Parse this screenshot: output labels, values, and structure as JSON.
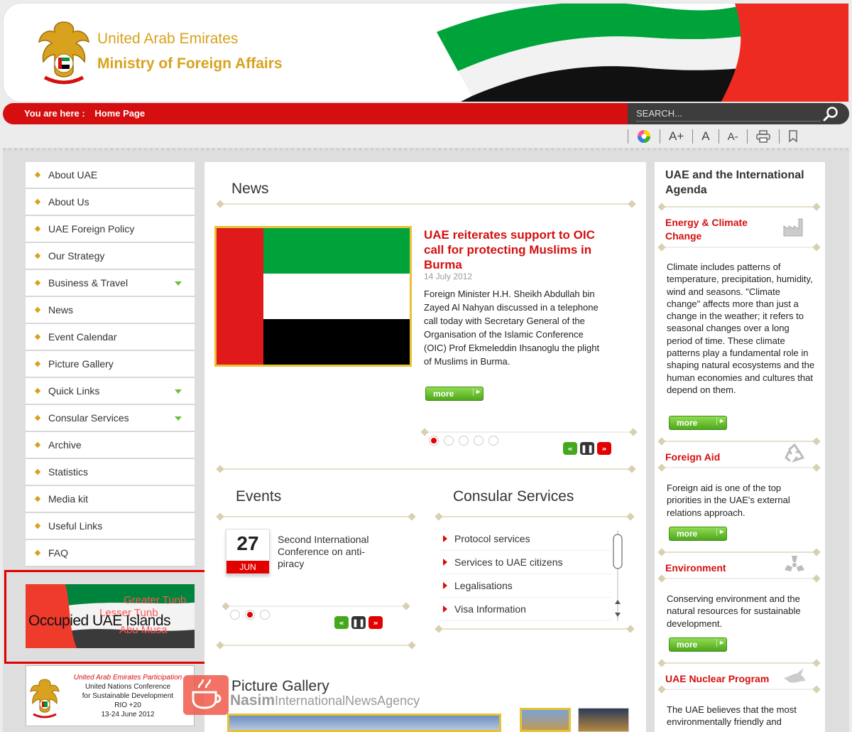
{
  "header": {
    "title": "United Arab Emirates",
    "subtitle": "Ministry of Foreign Affairs"
  },
  "breadcrumb": {
    "prefix": "You are here :",
    "current": "Home Page"
  },
  "search": {
    "placeholder": "SEARCH..."
  },
  "tools": {
    "increase": "A+",
    "normal": "A",
    "decrease": "A-"
  },
  "nav": [
    {
      "label": "About UAE",
      "has_submenu": false
    },
    {
      "label": "About Us",
      "has_submenu": false
    },
    {
      "label": "UAE Foreign Policy",
      "has_submenu": false
    },
    {
      "label": "Our Strategy",
      "has_submenu": false
    },
    {
      "label": "Business & Travel",
      "has_submenu": true
    },
    {
      "label": "News",
      "has_submenu": false
    },
    {
      "label": "Event Calendar",
      "has_submenu": false
    },
    {
      "label": "Picture Gallery",
      "has_submenu": false
    },
    {
      "label": "Quick Links",
      "has_submenu": true
    },
    {
      "label": "Consular Services",
      "has_submenu": true
    },
    {
      "label": "Archive",
      "has_submenu": false
    },
    {
      "label": "Statistics",
      "has_submenu": false
    },
    {
      "label": "Media kit",
      "has_submenu": false
    },
    {
      "label": "Useful Links",
      "has_submenu": false
    },
    {
      "label": "FAQ",
      "has_submenu": false
    }
  ],
  "islands": {
    "title": "Occupied UAE Islands",
    "names": [
      "Greater Tunb",
      "Lesser Tunb",
      "Abu Musa"
    ]
  },
  "rio": {
    "line1": "United Arab Emirates Participation",
    "line2": "United Nations Conference",
    "line3": "for Sustainable Development",
    "line4": "RIO +20",
    "line5": "13-24 June 2012"
  },
  "watermark": {
    "bold": "Nasim",
    "rest": "InternationalNewsAgency"
  },
  "news": {
    "section_title": "News",
    "headline": "UAE reiterates support to OIC call for protecting Muslims in Burma",
    "date": "14 July 2012",
    "body": "Foreign Minister H.H. Sheikh Abdullah bin Zayed Al Nahyan discussed in a telephone call today with Secretary General of the Organisation of the Islamic Conference (OIC) Prof Ekmeleddin Ihsanoglu the plight of Muslims in Burma.",
    "more": "more",
    "active_slide": 1,
    "slide_count": 5
  },
  "events": {
    "section_title": "Events",
    "day": "27",
    "month": "JUN",
    "text": "Second International Conference on anti-piracy",
    "active_slide": 2,
    "slide_count": 3
  },
  "consular": {
    "section_title": "Consular Services",
    "items": [
      "Protocol services",
      "Services to UAE citizens",
      "Legalisations",
      "Visa Information"
    ]
  },
  "gallery": {
    "section_title": "Picture Gallery"
  },
  "agenda": {
    "title": "UAE and the International Agenda",
    "items": [
      {
        "title": "Energy & Climate Change",
        "icon": "factory-icon",
        "text": "Climate includes patterns of temperature, precipitation, humidity, wind and seasons. \"Climate change\" affects more than just a change in the weather; it refers to seasonal changes over a long period of time. These climate patterns play a fundamental role in shaping natural ecosystems and the human economies and cultures that depend on them.",
        "more": "more"
      },
      {
        "title": "Foreign Aid",
        "icon": "recycle-icon",
        "text": "Foreign aid is one of the top priorities in the UAE's external relations approach.",
        "more": "more"
      },
      {
        "title": "Environment",
        "icon": "radiation-icon",
        "text": "Conserving environment and the natural resources for sustainable development.",
        "more": "more"
      },
      {
        "title": "UAE Nuclear Program",
        "icon": "dove-icon",
        "text": "The UAE believes that the most environmentally friendly and"
      }
    ]
  },
  "colors": {
    "brand_red": "#d50f0f",
    "gold": "#d8a21e",
    "flag_green": "#009739",
    "flag_black": "#000000"
  }
}
